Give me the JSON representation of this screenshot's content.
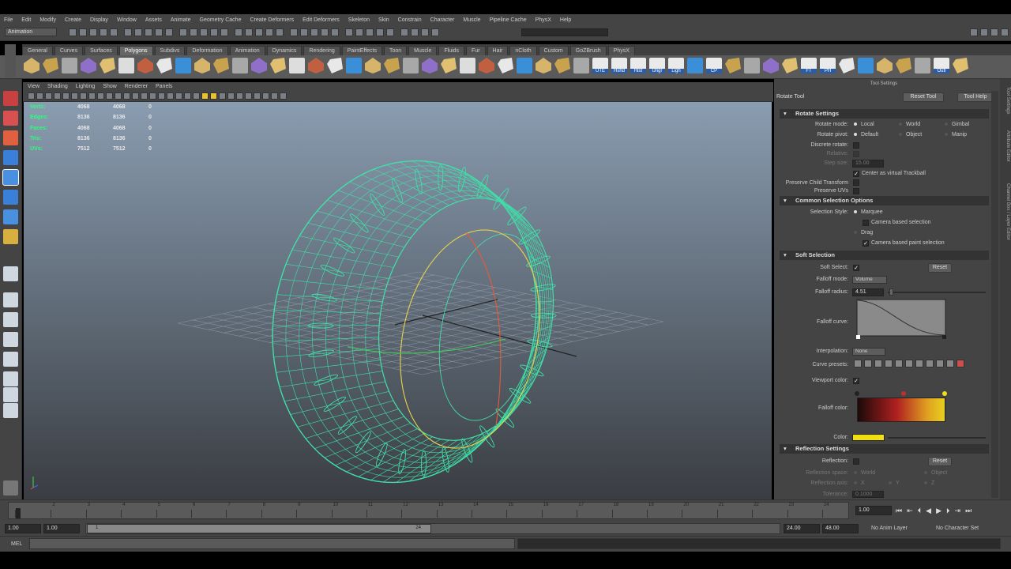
{
  "menu": [
    "File",
    "Edit",
    "Modify",
    "Create",
    "Display",
    "Window",
    "Assets",
    "Animate",
    "Geometry Cache",
    "Create Deformers",
    "Edit Deformers",
    "Skeleton",
    "Skin",
    "Constrain",
    "Character",
    "Muscle",
    "Pipeline Cache",
    "PhysX",
    "Help"
  ],
  "mode_select": "Animation",
  "shelf_tabs": [
    "General",
    "Curves",
    "Surfaces",
    "Polygons",
    "Subdivs",
    "Deformation",
    "Animation",
    "Dynamics",
    "Rendering",
    "PaintEffects",
    "Toon",
    "Muscle",
    "Fluids",
    "Fur",
    "Hair",
    "nCloth",
    "Custom",
    "GoZBrush",
    "PhysX"
  ],
  "shelf_active": "Polygons",
  "shelf_labels": {
    "ute": "UTE",
    "hshd": "Hshd",
    "hist": "Hist",
    "ungr": "Ungr",
    "ligh": "Ligh",
    "cp": "CP",
    "ft": "FT",
    "ph": "PH",
    "outl": "Outl"
  },
  "panel_menu": [
    "View",
    "Shading",
    "Lighting",
    "Show",
    "Renderer",
    "Panels"
  ],
  "hud": [
    {
      "label": "Verts:",
      "a": "4068",
      "b": "4068",
      "c": "0"
    },
    {
      "label": "Edges:",
      "a": "8136",
      "b": "8136",
      "c": "0"
    },
    {
      "label": "Faces:",
      "a": "4068",
      "b": "4068",
      "c": "0"
    },
    {
      "label": "Tris:",
      "a": "8136",
      "b": "8136",
      "c": "0"
    },
    {
      "label": "UVs:",
      "a": "7512",
      "b": "7512",
      "c": "0"
    }
  ],
  "tool_settings": {
    "panel_title": "Tool Settings",
    "tool_name": "Rotate Tool",
    "reset_tool": "Reset Tool",
    "tool_help": "Tool Help",
    "rotate": {
      "section": "Rotate Settings",
      "rotate_mode_label": "Rotate mode:",
      "rotate_modes": [
        "Local",
        "World",
        "Gimbal"
      ],
      "rotate_pivot_label": "Rotate pivot:",
      "rotate_pivots": [
        "Default",
        "Object",
        "Manip"
      ],
      "discrete_label": "Discrete rotate:",
      "relative_label": "Relative:",
      "step_label": "Step size:",
      "step_value": "15.00",
      "center_trackball": "Center as virtual Trackball",
      "preserve_child": "Preserve Child Transform",
      "preserve_uvs": "Preserve UVs"
    },
    "common": {
      "section": "Common Selection Options",
      "style_label": "Selection Style:",
      "marquee": "Marquee",
      "camera_based": "Camera based selection",
      "drag": "Drag",
      "camera_paint": "Camera based paint selection"
    },
    "soft": {
      "section": "Soft Selection",
      "soft_select_label": "Soft Select:",
      "reset": "Reset",
      "falloff_mode_label": "Falloff mode:",
      "falloff_mode": "Volume",
      "falloff_radius_label": "Falloff radius:",
      "falloff_radius": "4.51",
      "falloff_curve_label": "Falloff curve:",
      "interpolation_label": "Interpolation:",
      "interpolation": "None",
      "curve_presets_label": "Curve presets:",
      "viewport_color_label": "Viewport color:",
      "falloff_color_label": "Falloff color:",
      "color_label": "Color:",
      "color_swatch": "#f0e010"
    },
    "reflection": {
      "section": "Reflection Settings",
      "reflection_label": "Reflection:",
      "reset": "Reset",
      "space_label": "Reflection space:",
      "spaces": [
        "World",
        "Object"
      ],
      "axis_label": "Reflection axis:",
      "axes": [
        "X",
        "Y",
        "Z"
      ],
      "tolerance_label": "Tolerance:",
      "tolerance": "0.1000"
    }
  },
  "right_tabs": [
    "Tool Settings",
    "Attribute Editor",
    "Channel Box / Layer Editor"
  ],
  "timeline": {
    "ticks": [
      "1",
      "2",
      "3",
      "4",
      "5",
      "6",
      "7",
      "8",
      "9",
      "10",
      "11",
      "12",
      "13",
      "14",
      "15",
      "16",
      "17",
      "18",
      "19",
      "20",
      "21",
      "22",
      "23",
      "24"
    ],
    "current_frame": "1.00"
  },
  "range": {
    "start": "1.00",
    "playback_start": "1.00",
    "slider_start": "1",
    "slider_end": "24",
    "playback_end": "24.00",
    "end": "48.00",
    "anim_layer": "No Anim Layer",
    "character_set": "No Character Set"
  },
  "command_line": {
    "label": "MEL"
  },
  "colors": {
    "wire": "#3fe0a8",
    "accent_yellow": "#f0e010"
  }
}
